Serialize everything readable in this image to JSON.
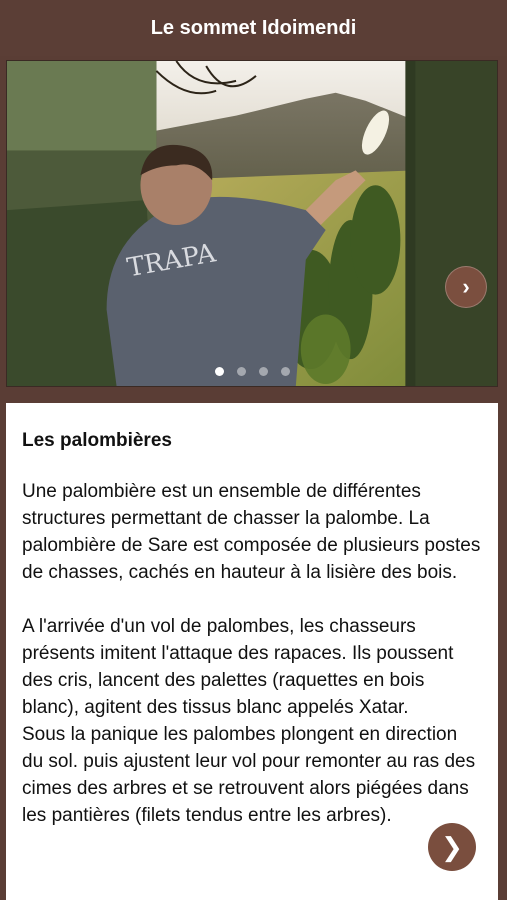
{
  "header": {
    "title": "Le sommet Idoimendi"
  },
  "slider": {
    "total_slides": 4,
    "active_slide": 1,
    "next_glyph": "›",
    "photo_icon": "photo-man-throwing-palette"
  },
  "content": {
    "title": "Les palombières",
    "paragraph1": "Une palombière est un ensemble de différentes structures permettant de chasser la palombe. La palombière de Sare est composée de plusieurs postes de chasses, cachés en hauteur à la lisière des bois.",
    "paragraph2": "A l'arrivée d'un vol de palombes, les chasseurs présents imitent l'attaque des rapaces. Ils poussent des cris, lancent des palettes (raquettes en bois blanc), agitent des tissus blanc appelés Xatar.",
    "paragraph3": "Sous la panique les palombes plongent en direction du sol. puis ajustent leur vol pour remonter au ras des cimes des arbres et se retrouvent alors piégées dans les pantières (filets tendus entre les arbres)."
  },
  "float_button": {
    "glyph": "❯"
  },
  "colors": {
    "header": "#5b3e36",
    "accent": "#7a4e3e",
    "background": "#5a3d35"
  }
}
